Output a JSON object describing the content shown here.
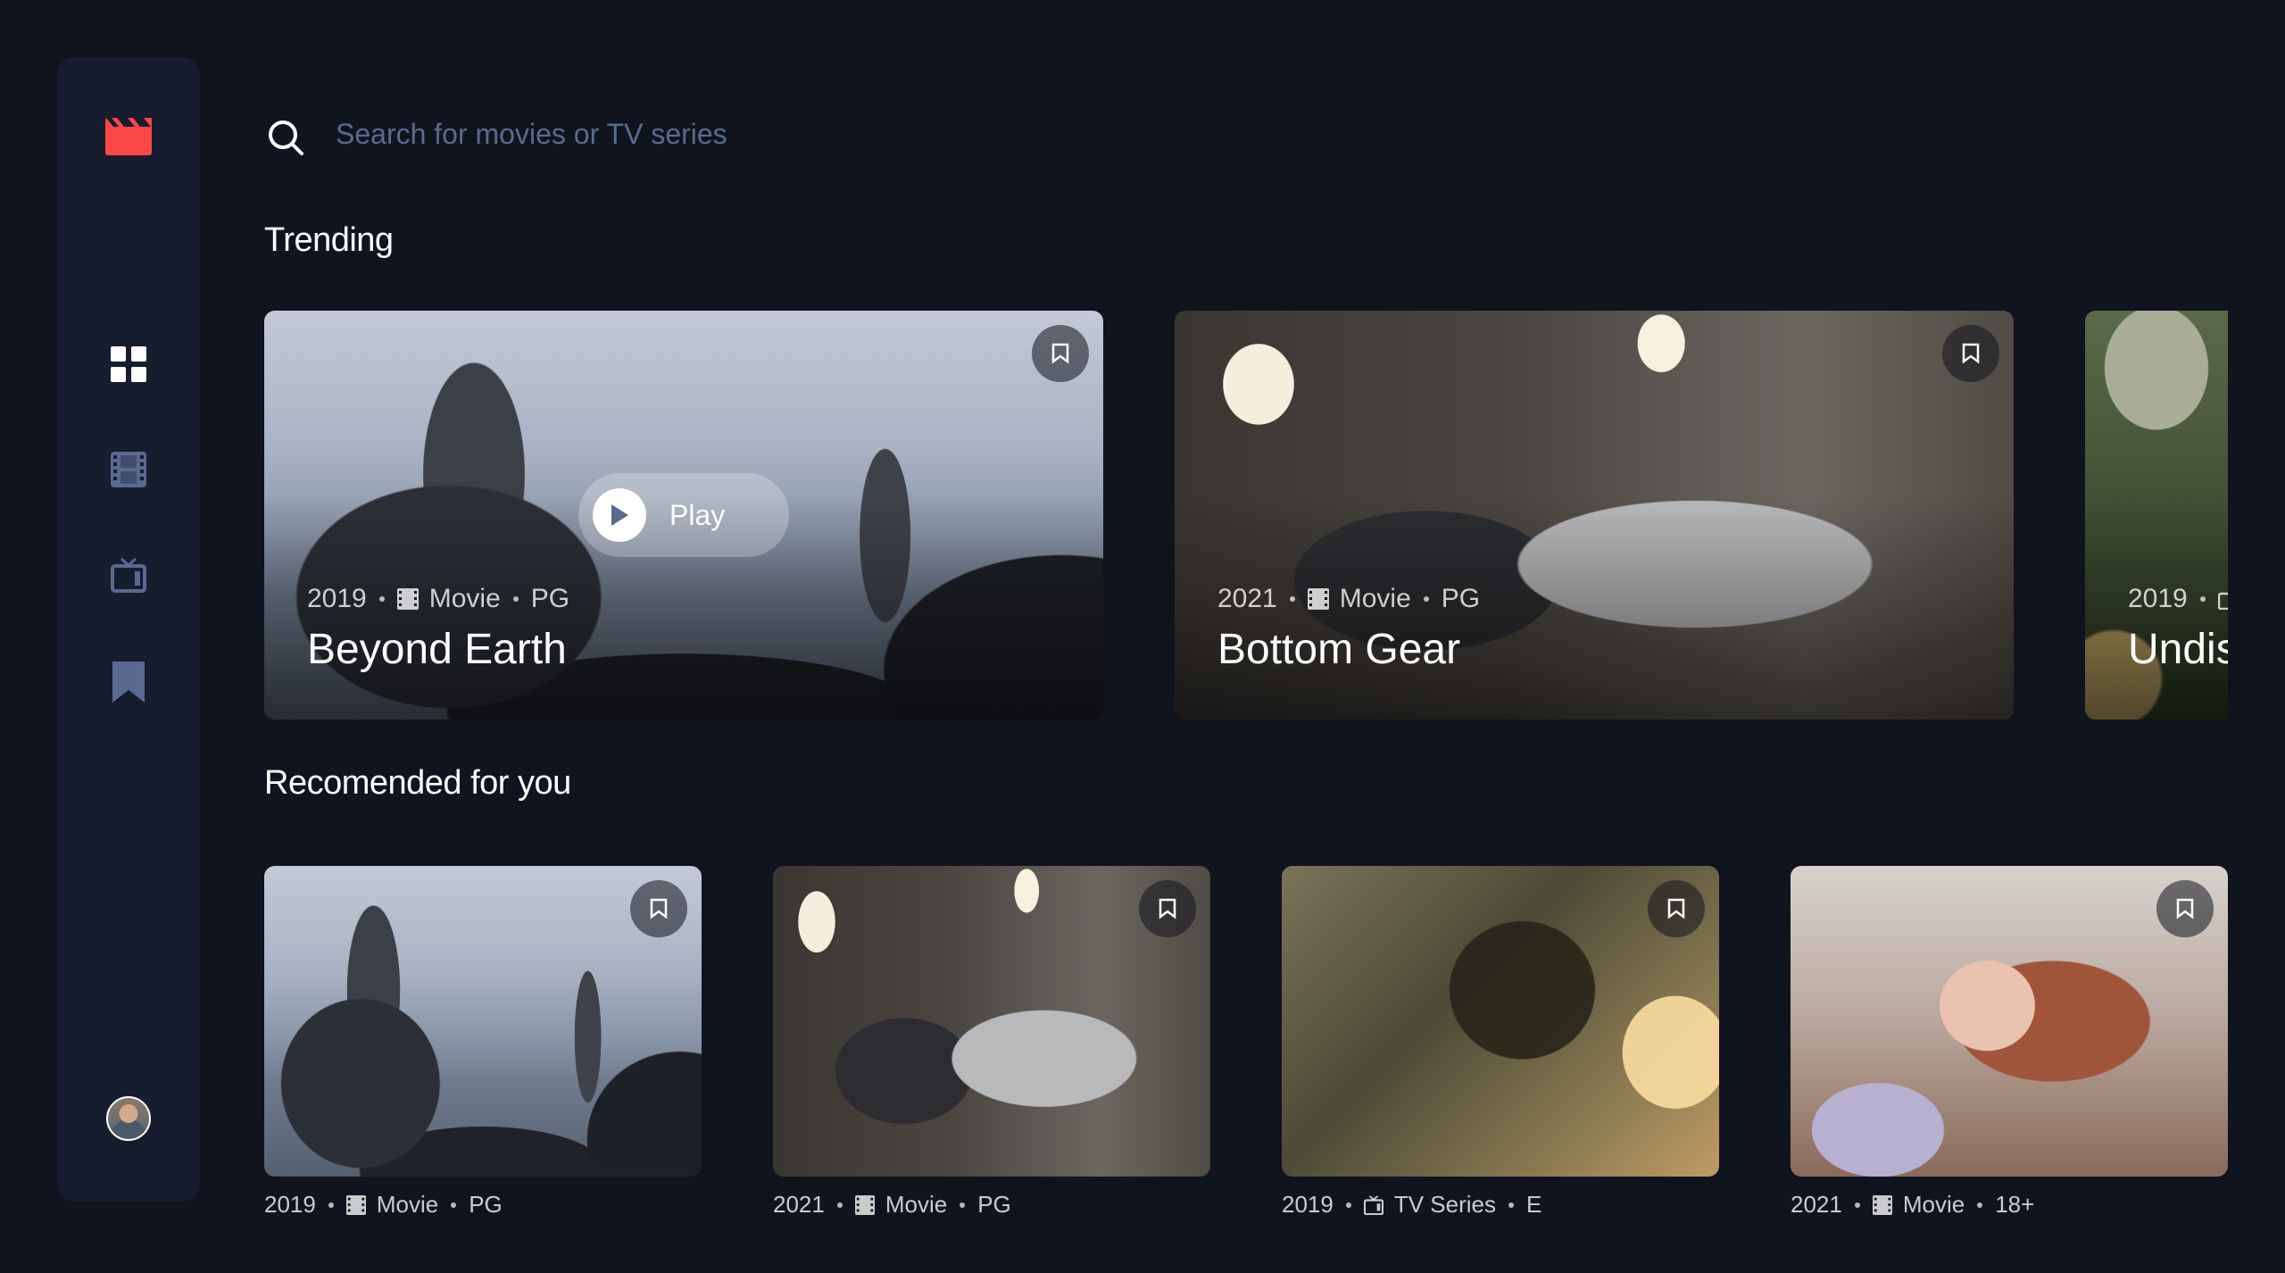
{
  "search": {
    "placeholder": "Search for movies or TV series"
  },
  "icons": {
    "logo": "clapperboard-icon",
    "nav": [
      "grid-icon",
      "film-icon",
      "tv-icon",
      "bookmark-icon"
    ],
    "search": "search-icon"
  },
  "colors": {
    "background": "#10141E",
    "sidebar": "#161D2F",
    "accent": "#FC4747",
    "nav_active": "#FFFFFF",
    "nav_inactive": "#5A698F"
  },
  "sections": {
    "trending": "Trending",
    "recommended": "Recomended for you"
  },
  "trending": [
    {
      "year": "2019",
      "category": "Movie",
      "rating": "PG",
      "title": "Beyond Earth",
      "play_label": "Play"
    },
    {
      "year": "2021",
      "category": "Movie",
      "rating": "PG",
      "title": "Bottom Gear"
    },
    {
      "year": "2019",
      "title_visible": "Undis"
    }
  ],
  "recommended": [
    {
      "year": "2019",
      "category": "Movie",
      "rating": "PG"
    },
    {
      "year": "2021",
      "category": "Movie",
      "rating": "PG"
    },
    {
      "year": "2019",
      "category": "TV Series",
      "rating": "E"
    },
    {
      "year": "2021",
      "category": "Movie",
      "rating": "18+"
    }
  ]
}
